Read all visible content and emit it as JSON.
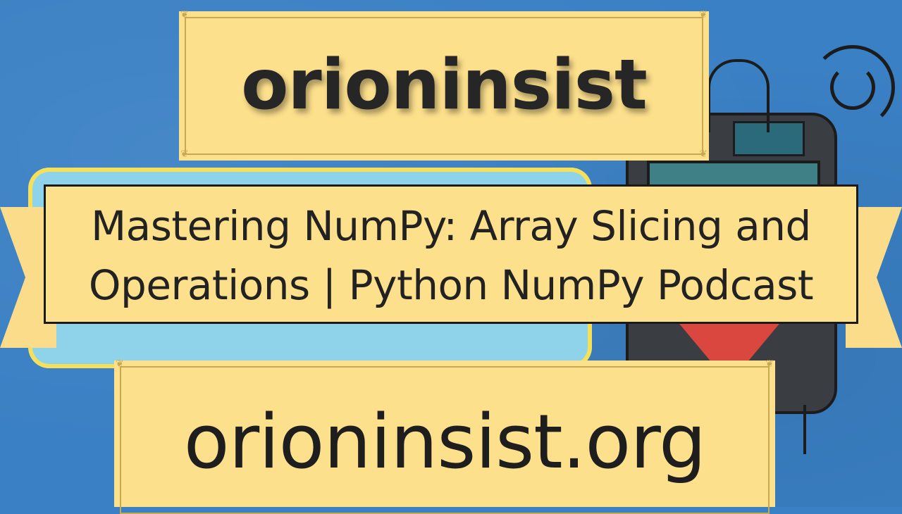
{
  "brand": {
    "name": "orioninsist",
    "domain": "orioninsist.org"
  },
  "episode": {
    "title_line_1": "Mastering NumPy: Array Slicing and",
    "title_line_2": "Operations | Python NumPy Podcast"
  },
  "colors": {
    "background": "#3a80c4",
    "panel": "#fde08c",
    "text": "#222222"
  }
}
